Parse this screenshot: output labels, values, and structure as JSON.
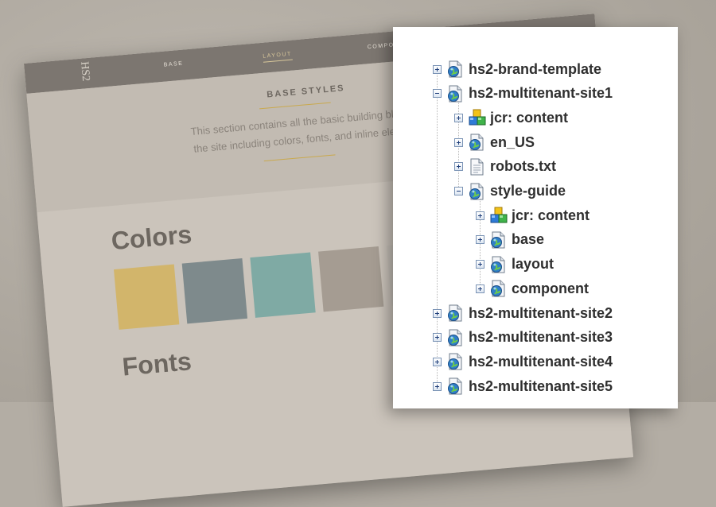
{
  "style_guide": {
    "logo": "HS2",
    "nav": [
      "BASE",
      "LAYOUT",
      "COMPONENTS"
    ],
    "active_nav": "LAYOUT",
    "kicker": "BASE STYLES",
    "intro_line1": "This section contains all the basic building blocks of",
    "intro_line2": "the site including colors, fonts, and inline elements.",
    "colors_heading": "Colors",
    "fonts_heading": "Fonts",
    "swatches": [
      "#d2b56b",
      "#7e8a8c",
      "#7faaa4",
      "#a59c92",
      "#c6c0b8"
    ]
  },
  "tree": [
    {
      "label": "hs2-brand-template",
      "icon": "page-globe-icon",
      "level": 0,
      "expanded": false
    },
    {
      "label": "hs2-multitenant-site1",
      "icon": "page-globe-icon",
      "level": 0,
      "expanded": true
    },
    {
      "label": "jcr: content",
      "icon": "cubes-icon",
      "level": 1,
      "expanded": false
    },
    {
      "label": "en_US",
      "icon": "page-globe-icon",
      "level": 1,
      "expanded": false
    },
    {
      "label": "robots.txt",
      "icon": "file-icon",
      "level": 1,
      "expanded": false
    },
    {
      "label": "style-guide",
      "icon": "page-globe-icon",
      "level": 1,
      "expanded": true
    },
    {
      "label": "jcr: content",
      "icon": "cubes-icon",
      "level": 2,
      "expanded": false
    },
    {
      "label": "base",
      "icon": "page-globe-icon",
      "level": 2,
      "expanded": false
    },
    {
      "label": "layout",
      "icon": "page-globe-icon",
      "level": 2,
      "expanded": false
    },
    {
      "label": "component",
      "icon": "page-globe-icon",
      "level": 2,
      "expanded": false
    },
    {
      "label": "hs2-multitenant-site2",
      "icon": "page-globe-icon",
      "level": 0,
      "expanded": false
    },
    {
      "label": "hs2-multitenant-site3",
      "icon": "page-globe-icon",
      "level": 0,
      "expanded": false
    },
    {
      "label": "hs2-multitenant-site4",
      "icon": "page-globe-icon",
      "level": 0,
      "expanded": false
    },
    {
      "label": "hs2-multitenant-site5",
      "icon": "page-globe-icon",
      "level": 0,
      "expanded": false
    }
  ]
}
